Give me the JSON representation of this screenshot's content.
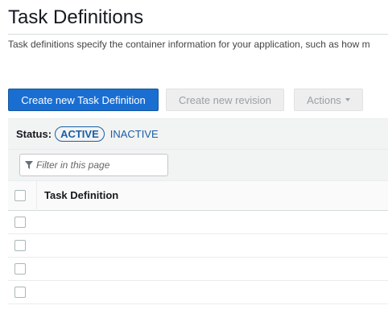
{
  "page": {
    "title": "Task Definitions",
    "description": "Task definitions specify the container information for your application, such as how m"
  },
  "toolbar": {
    "create_label": "Create new Task Definition",
    "revision_label": "Create new revision",
    "actions_label": "Actions"
  },
  "status_filter": {
    "label": "Status:",
    "active": "ACTIVE",
    "inactive": "INACTIVE"
  },
  "filter": {
    "placeholder": "Filter in this page",
    "icon": "funnel-icon"
  },
  "table": {
    "columns": [
      "Task Definition"
    ],
    "rows": [
      {
        "name": ""
      },
      {
        "name": ""
      },
      {
        "name": ""
      },
      {
        "name": ""
      }
    ]
  },
  "colors": {
    "primary": "#1a6ed1",
    "link": "#1a5fa8",
    "disabled_text": "#9aa0a6"
  }
}
